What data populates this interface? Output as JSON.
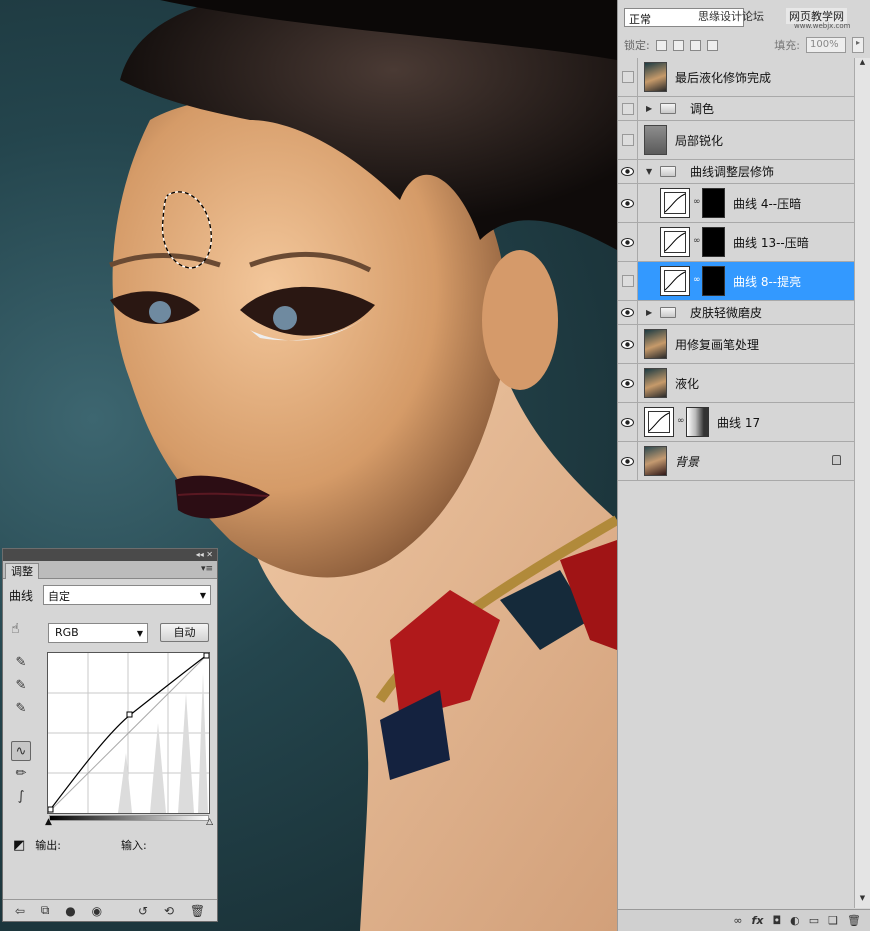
{
  "layers_panel": {
    "blend_mode": "正常",
    "watermark_text": "思缘设计论坛",
    "watermark_site": "网页教学网",
    "watermark_url": "www.webjx.com",
    "lock_label": "锁定:",
    "fill_label": "填充:",
    "fill_value": "100%",
    "layers": [
      {
        "name": "最后液化修饰完成",
        "visible": false,
        "kind": "pixel"
      },
      {
        "name": "调色",
        "visible": false,
        "kind": "group",
        "expanded": false
      },
      {
        "name": "局部锐化",
        "visible": false,
        "kind": "gray"
      },
      {
        "name": "曲线调整层修饰",
        "visible": true,
        "kind": "group",
        "expanded": true
      },
      {
        "name": "曲线 4--压暗",
        "visible": true,
        "kind": "curves"
      },
      {
        "name": "曲线 13--压暗",
        "visible": true,
        "kind": "curves"
      },
      {
        "name": "曲线 8--提亮",
        "visible": false,
        "kind": "curves",
        "selected": true
      },
      {
        "name": "皮肤轻微磨皮",
        "visible": true,
        "kind": "group",
        "expanded": false
      },
      {
        "name": "用修复画笔处理",
        "visible": true,
        "kind": "pixel"
      },
      {
        "name": "液化",
        "visible": true,
        "kind": "pixel"
      },
      {
        "name": "曲线 17",
        "visible": true,
        "kind": "curves-mask"
      },
      {
        "name": "背景",
        "visible": true,
        "kind": "background",
        "locked": true
      }
    ]
  },
  "adjust_panel": {
    "tab_label": "调整",
    "adjustment_type": "曲线",
    "preset": "自定",
    "channel": "RGB",
    "auto_button": "自动",
    "output_label": "输出:",
    "input_label": "输入:"
  }
}
